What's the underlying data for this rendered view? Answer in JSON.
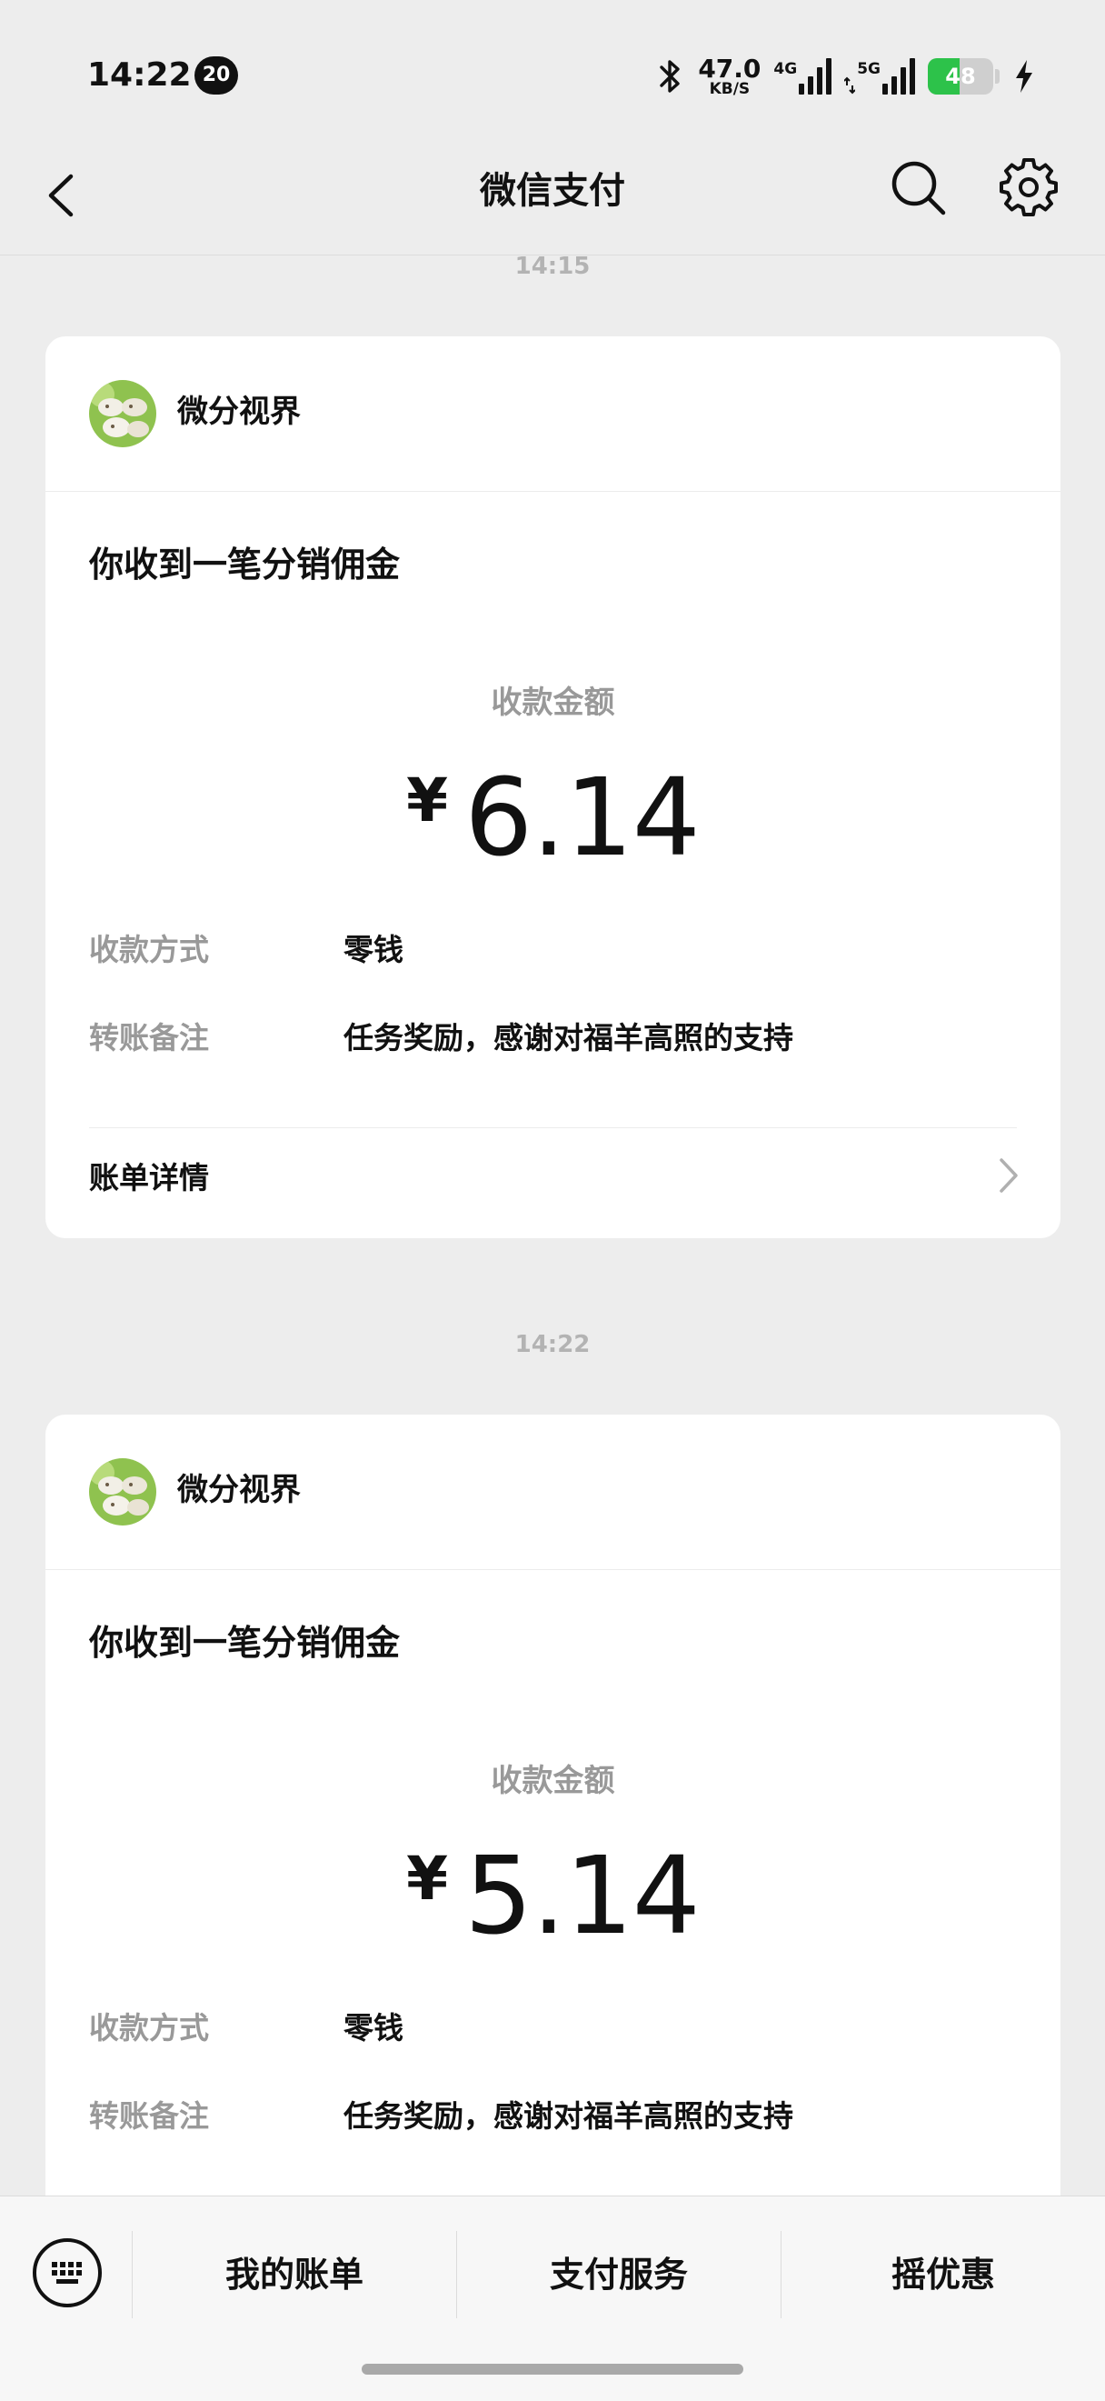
{
  "status_bar": {
    "time": "14:22",
    "notification_count": "20",
    "net_speed_value": "47.0",
    "net_speed_unit": "KB/S",
    "sim1_label": "4G",
    "sim2_label": "5G",
    "battery_level": "48",
    "battery_fraction": 0.48,
    "battery_color": "#2dc24a"
  },
  "nav": {
    "title": "微信支付",
    "back_icon": "chevron-left-icon",
    "search_icon": "search-icon",
    "settings_icon": "gear-icon"
  },
  "feed": {
    "top_time": "14:15",
    "messages": [
      {
        "merchant": "微分视界",
        "title": "你收到一笔分销佣金",
        "amount_label": "收款金额",
        "currency": "¥",
        "amount": "6.14",
        "rows": [
          {
            "key": "收款方式",
            "value": "零钱"
          },
          {
            "key": "转账备注",
            "value": "任务奖励，感谢对福羊高照的支持"
          }
        ],
        "details_label": "账单详情"
      },
      {
        "time": "14:22",
        "merchant": "微分视界",
        "title": "你收到一笔分销佣金",
        "amount_label": "收款金额",
        "currency": "¥",
        "amount": "5.14",
        "rows": [
          {
            "key": "收款方式",
            "value": "零钱"
          },
          {
            "key": "转账备注",
            "value": "任务奖励，感谢对福羊高照的支持"
          }
        ]
      }
    ]
  },
  "bottom_bar": {
    "keyboard_icon": "keyboard-icon",
    "items": [
      {
        "label": "我的账单"
      },
      {
        "label": "支付服务"
      },
      {
        "label": "摇优惠"
      }
    ]
  },
  "colors": {
    "background": "#ededed",
    "card": "#ffffff",
    "muted_text": "#999999"
  }
}
